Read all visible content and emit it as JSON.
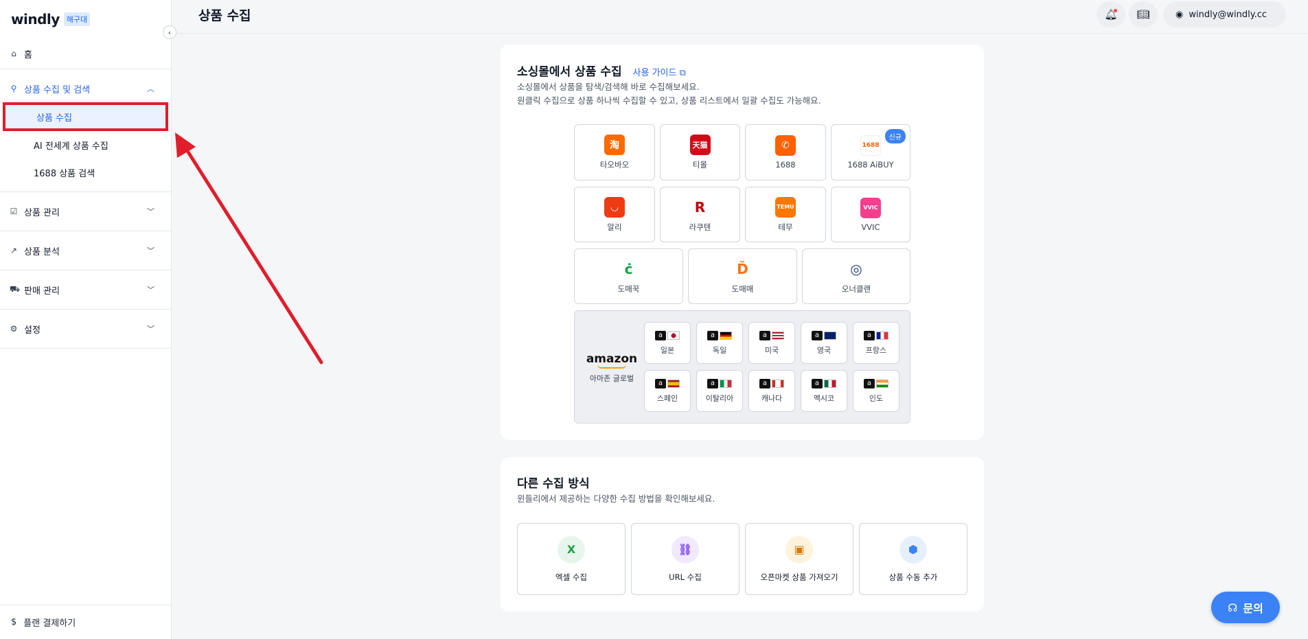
{
  "sidebar": {
    "logo": "windly",
    "logo_badge": "해구대",
    "home": "홈",
    "group_collect": "상품 수집 및 검색",
    "sub_items": [
      "상품 수집",
      "AI 전세계 상품 수집",
      "1688 상품 검색"
    ],
    "group_manage": "상품 관리",
    "group_analysis": "상품 분석",
    "group_sales": "판매 관리",
    "group_settings": "설정",
    "plan": "플랜 결제하기"
  },
  "header": {
    "title": "상품 수집",
    "user_email": "windly@windly.cc"
  },
  "shop_section": {
    "title": "소싱몰에서 상품 수집",
    "guide_link": "사용 가이드",
    "desc_line1": "소싱몰에서 상품을 탐색/검색해 바로 수집해보세요.",
    "desc_line2": "원클릭 수집으로 상품 하나씩 수집할 수 있고, 상품 리스트에서 일괄 수집도 가능해요.",
    "shops_row1": [
      "타오바오",
      "티몰",
      "1688",
      "1688 AiBUY"
    ],
    "shops_row2": [
      "알리",
      "라쿠텐",
      "테무",
      "VVIC"
    ],
    "shops_row3": [
      "도매꾹",
      "도매매",
      "오너클랜"
    ],
    "new_badge": "신규",
    "amazon_logo": "amazon",
    "amazon_label": "아마존 글로벌",
    "amazon_countries": [
      "일본",
      "독일",
      "미국",
      "영국",
      "프랑스",
      "스페인",
      "이탈리아",
      "캐나다",
      "멕시코",
      "인도"
    ]
  },
  "other_section": {
    "title": "다른 수집 방식",
    "desc": "윈들리에서 제공하는 다양한 수집 방법을 확인해보세요.",
    "methods": [
      "엑셀 수집",
      "URL 수집",
      "오픈마켓 상품 가져오기",
      "상품 수동 추가"
    ]
  },
  "chat_button": "문의",
  "colors": {
    "accent": "#2563eb",
    "highlight_red": "#e11d2b"
  }
}
